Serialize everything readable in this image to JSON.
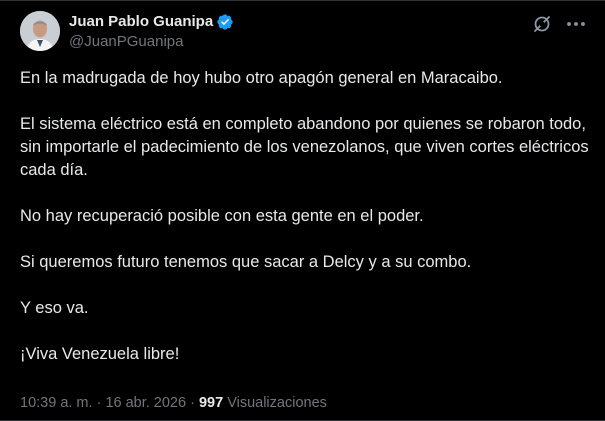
{
  "author": {
    "display_name": "Juan Pablo Guanipa",
    "handle": "@JuanPGuanipa",
    "verified_badge_color": "#1d9bf0"
  },
  "header_icons": [
    "grok-icon",
    "more-icon"
  ],
  "post": {
    "paragraphs": [
      "En la madrugada de hoy hubo otro apagón general en Maracaibo.",
      "El sistema eléctrico está en completo abandono por quienes se robaron todo, sin importarle el padecimiento de los venezolanos, que viven cortes eléctricos cada día.",
      "No hay recuperació posible con esta gente en el poder.",
      "Si queremos futuro tenemos que sacar a Delcy y a su combo.",
      "Y eso va.",
      "¡Viva Venezuela libre!"
    ]
  },
  "meta": {
    "time": "10:39 a. m.",
    "separator": " · ",
    "date": "16 abr. 2026",
    "views_count": "997",
    "views_label": "Visualizaciones"
  },
  "colors": {
    "background": "#000000",
    "text": "#e7e9ea",
    "secondary": "#71767b",
    "accent": "#1d9bf0"
  }
}
